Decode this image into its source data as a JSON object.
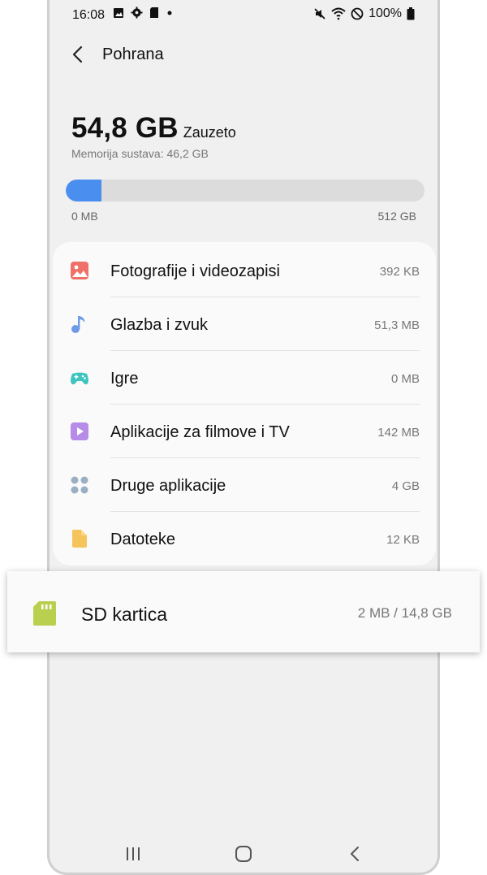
{
  "status_bar": {
    "time": "16:08",
    "battery": "100%",
    "left_icons": [
      "image-icon",
      "gear-icon",
      "sd-card-icon",
      "dot-icon"
    ],
    "right_icons": [
      "mute-icon",
      "wifi-icon",
      "do-not-disturb-icon",
      "battery-icon"
    ]
  },
  "header": {
    "title": "Pohrana"
  },
  "storage": {
    "used_amount": "54,8 GB",
    "used_label": "Zauzeto",
    "system_memory": "Memorija sustava: 46,2 GB",
    "bar_min": "0 MB",
    "bar_max": "512 GB",
    "bar_fill_fraction": 0.1,
    "bar_color": "#4a8ff0"
  },
  "categories": [
    {
      "label": "Fotografije i videozapisi",
      "size": "392 KB",
      "icon": "photo-icon",
      "color": "#f07068"
    },
    {
      "label": "Glazba i zvuk",
      "size": "51,3 MB",
      "icon": "music-note-icon",
      "color": "#6f9ae8"
    },
    {
      "label": "Igre",
      "size": "0 MB",
      "icon": "gamepad-icon",
      "color": "#3fc4bf"
    },
    {
      "label": "Aplikacije za filmove i TV",
      "size": "142 MB",
      "icon": "video-play-icon",
      "color": "#b68ce8"
    },
    {
      "label": "Druge aplikacije",
      "size": "4 GB",
      "icon": "apps-grid-icon",
      "color": "#9aaec4"
    },
    {
      "label": "Datoteke",
      "size": "12 KB",
      "icon": "file-icon",
      "color": "#f6c45c"
    }
  ],
  "sd_card": {
    "label": "SD kartica",
    "size": "2 MB / 14,8 GB",
    "icon": "sd-card-icon",
    "color": "#b9cf4e"
  },
  "nav_bar": {
    "buttons": [
      "recents-icon",
      "home-icon",
      "back-nav-icon"
    ]
  }
}
